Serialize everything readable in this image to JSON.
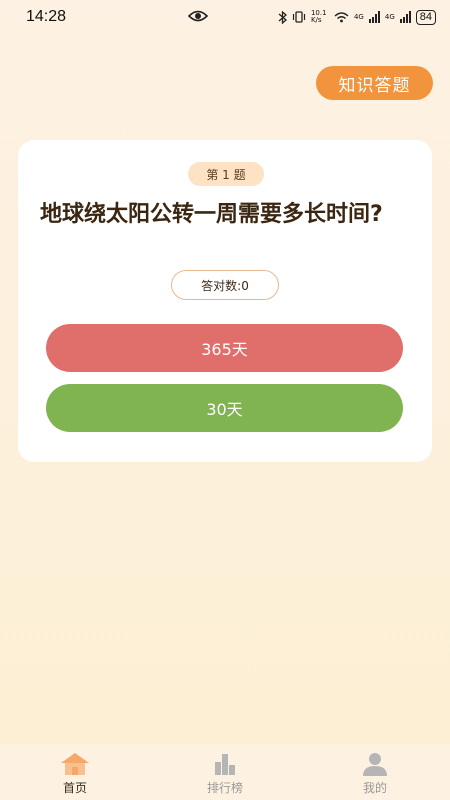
{
  "status_bar": {
    "time": "14:28",
    "net_speed": "10.1 K/s",
    "signal1": "4G",
    "signal2": "4G",
    "battery": "84",
    "icons": [
      "eye-icon",
      "bluetooth-icon",
      "vibrate-icon",
      "wifi-icon",
      "signal-icon",
      "battery-icon"
    ]
  },
  "header": {
    "quiz_button_label": "知识答题"
  },
  "card": {
    "badge": "第 1 题",
    "question": "地球绕太阳公转一周需要多长时间?",
    "score_label": "答对数:0",
    "options": [
      "365天",
      "30天"
    ]
  },
  "nav": {
    "items": [
      {
        "label": "首页",
        "icon": "home-icon",
        "active": true
      },
      {
        "label": "排行榜",
        "icon": "bar-chart-icon",
        "active": false
      },
      {
        "label": "我的",
        "icon": "user-icon",
        "active": false
      }
    ]
  },
  "colors": {
    "accent": "#f2943e",
    "option_red": "#e06e6b",
    "option_green": "#80b450",
    "badge_bg": "#fde3c4"
  }
}
